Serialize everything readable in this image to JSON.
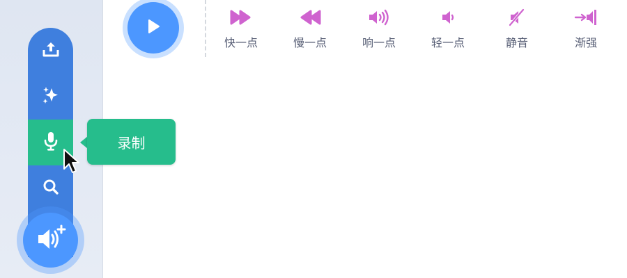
{
  "sidebar": {
    "menu_items": [
      {
        "icon": "upload-icon",
        "label": ""
      },
      {
        "icon": "sparkle-icon",
        "label": ""
      },
      {
        "icon": "microphone-icon",
        "label": "录制",
        "active": true
      },
      {
        "icon": "search-icon",
        "label": ""
      }
    ],
    "tooltip_label": "录制",
    "add_sound_icon": "speaker-plus-icon"
  },
  "toolbar": {
    "play_icon": "play-icon",
    "effects": [
      {
        "label": "快一点",
        "icon": "faster-icon"
      },
      {
        "label": "慢一点",
        "icon": "slower-icon"
      },
      {
        "label": "响一点",
        "icon": "louder-icon"
      },
      {
        "label": "轻一点",
        "icon": "softer-icon"
      },
      {
        "label": "静音",
        "icon": "mute-icon"
      },
      {
        "label": "渐强",
        "icon": "fade-in-icon"
      }
    ]
  },
  "colors": {
    "menu_blue": "#3f7fde",
    "primary_blue": "#4c97ff",
    "record_green": "#26bd8c",
    "effect_magenta": "#cf63cf",
    "label_gray": "#575e75"
  }
}
